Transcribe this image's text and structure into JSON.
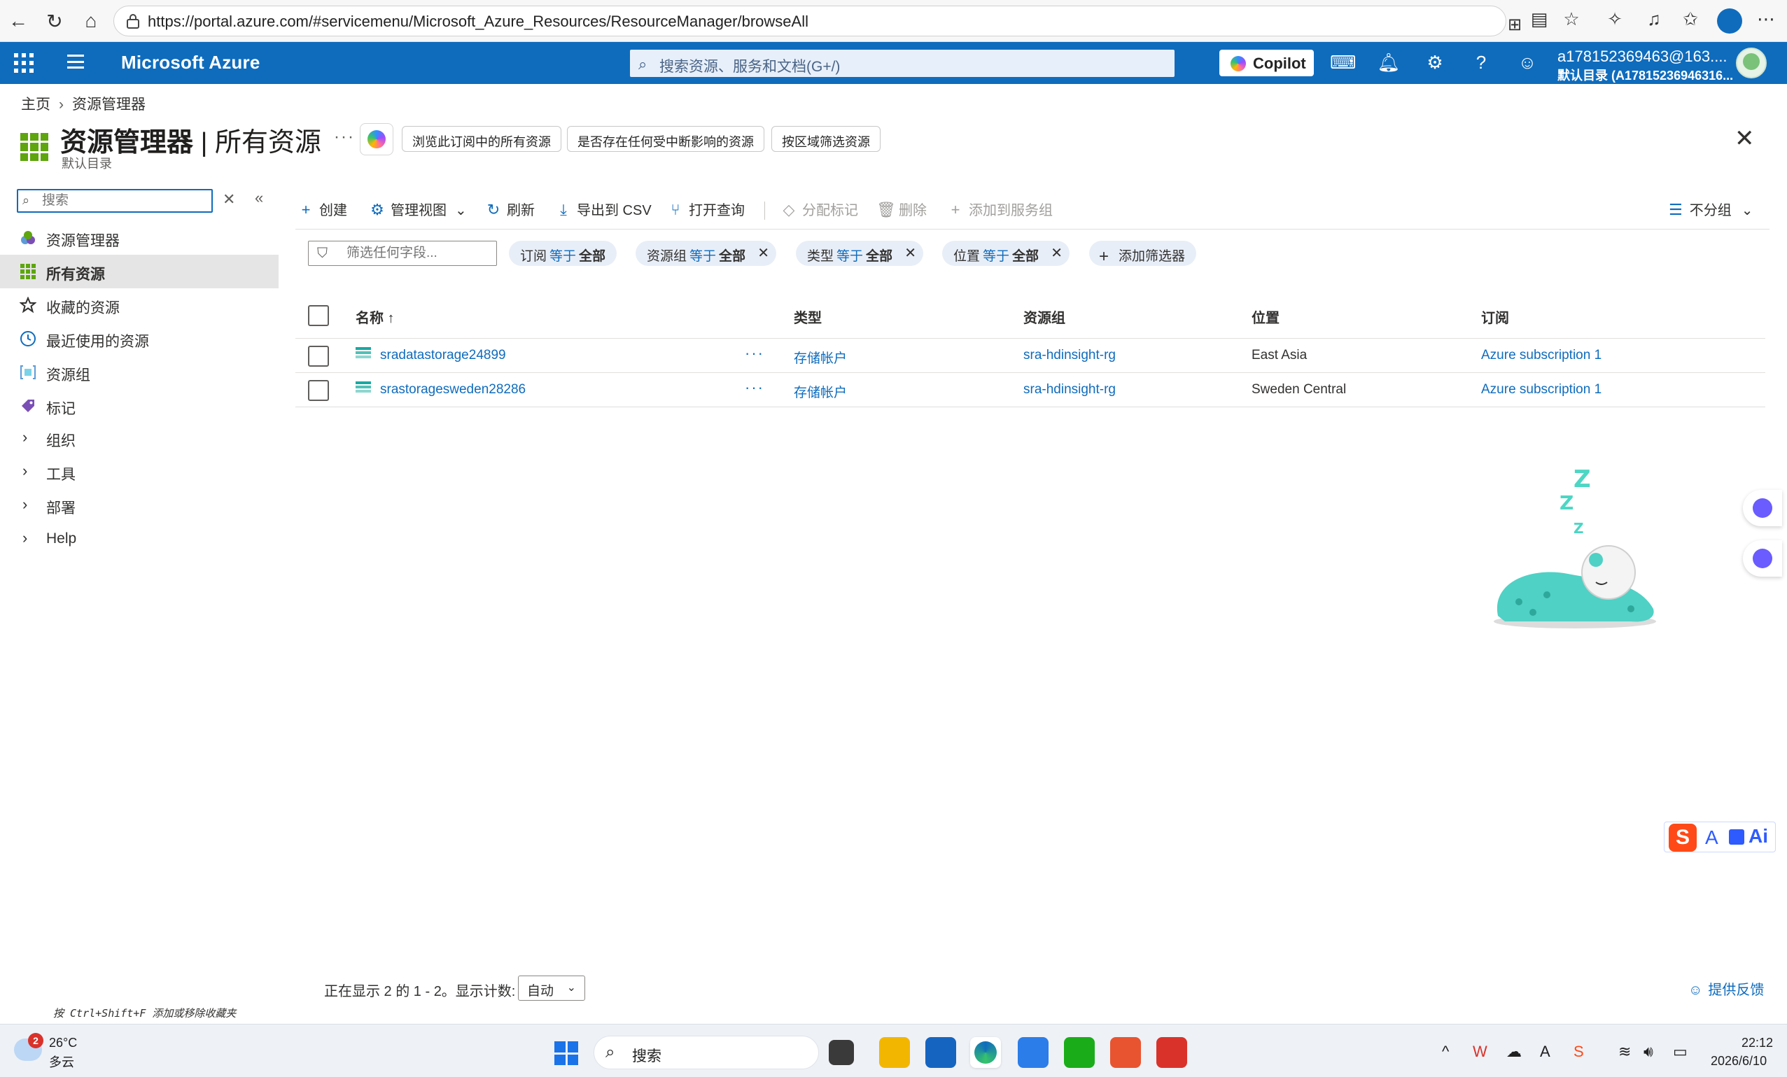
{
  "browser": {
    "url": "https://portal.azure.com/#servicemenu/Microsoft_Azure_Resources/ResourceManager/browseAll"
  },
  "azure_header": {
    "brand": "Microsoft Azure",
    "search_placeholder": "搜索资源、服务和文档(G+/)",
    "copilot_label": "Copilot",
    "account_name": "a178152369463@163....",
    "account_directory": "默认目录 (A17815236946316..."
  },
  "breadcrumb": {
    "home": "主页",
    "current": "资源管理器"
  },
  "page": {
    "title_main": "资源管理器",
    "title_separator": " | ",
    "title_sub": "所有资源",
    "subtitle": "默认目录",
    "more": "···",
    "quick_actions": [
      "浏览此订阅中的所有资源",
      "是否存在任何受中断影响的资源",
      "按区域筛选资源"
    ]
  },
  "sidebar": {
    "search_placeholder": "搜索",
    "items": [
      {
        "label": "资源管理器",
        "icon": "resource-manager-icon"
      },
      {
        "label": "所有资源",
        "icon": "grid-icon",
        "active": true
      },
      {
        "label": "收藏的资源",
        "icon": "star-icon"
      },
      {
        "label": "最近使用的资源",
        "icon": "clock-icon"
      },
      {
        "label": "资源组",
        "icon": "resource-group-icon"
      },
      {
        "label": "标记",
        "icon": "tag-icon"
      }
    ],
    "groups": [
      "组织",
      "工具",
      "部署",
      "Help"
    ]
  },
  "toolbar": {
    "create": "创建",
    "manage_view": "管理视图",
    "refresh": "刷新",
    "export_csv": "导出到 CSV",
    "open_query": "打开查询",
    "assign_tags": "分配标记",
    "delete": "删除",
    "add_to_service_group": "添加到服务组",
    "grouping": "不分组"
  },
  "filters": {
    "placeholder": "筛选任何字段...",
    "chips": [
      {
        "field": "订阅",
        "op": "等于",
        "value": "全部",
        "removable": false
      },
      {
        "field": "资源组",
        "op": "等于",
        "value": "全部",
        "removable": true
      },
      {
        "field": "类型",
        "op": "等于",
        "value": "全部",
        "removable": true
      },
      {
        "field": "位置",
        "op": "等于",
        "value": "全部",
        "removable": true
      }
    ],
    "add_filter": "添加筛选器"
  },
  "table": {
    "columns": {
      "name": "名称 ↑",
      "type": "类型",
      "resource_group": "资源组",
      "location": "位置",
      "subscription": "订阅"
    },
    "rows": [
      {
        "name": "sradatastorage24899",
        "type": "存储帐户",
        "resource_group": "sra-hdinsight-rg",
        "location": "East Asia",
        "subscription": "Azure subscription 1"
      },
      {
        "name": "srastoragesweden28286",
        "type": "存储帐户",
        "resource_group": "sra-hdinsight-rg",
        "location": "Sweden Central",
        "subscription": "Azure subscription 1"
      }
    ]
  },
  "footer": {
    "pager_text": "正在显示 2 的 1 - 2。显示计数:",
    "page_size": "自动",
    "feedback": "提供反馈",
    "hint": "按 Ctrl+Shift+F 添加或移除收藏夹"
  },
  "taskbar": {
    "weather_badge": "2",
    "temperature": "26°C",
    "weather": "多云",
    "search_label": "搜索",
    "time": "22:12",
    "date": "2026/6/10"
  }
}
